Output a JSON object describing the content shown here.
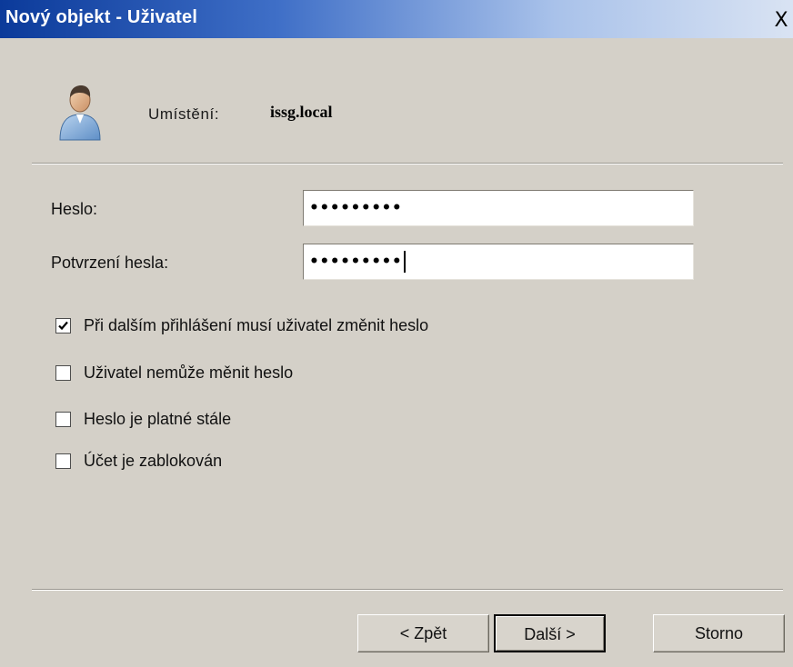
{
  "window": {
    "title": "Nový objekt - Uživatel",
    "close_glyph": "X"
  },
  "location": {
    "label": "Umístění:",
    "value": "issg.local",
    "icon": "user-icon"
  },
  "password": {
    "label": "Heslo:",
    "value": "•••••••••"
  },
  "confirm_password": {
    "label": "Potvrzení hesla:",
    "value": "•••••••••"
  },
  "options": [
    {
      "label": "Při dalším přihlášení musí uživatel změnit heslo",
      "checked": true
    },
    {
      "label": "Uživatel nemůže měnit heslo",
      "checked": false
    },
    {
      "label": "Heslo je platné stále",
      "checked": false
    },
    {
      "label": "Účet je zablokován",
      "checked": false
    }
  ],
  "buttons": {
    "back_label": "< Zpět",
    "next_label": "Další >",
    "cancel_label": "Storno"
  },
  "colors": {
    "titlebar_start": "#0b3a9a",
    "dialog_background": "#d4d0c8"
  }
}
